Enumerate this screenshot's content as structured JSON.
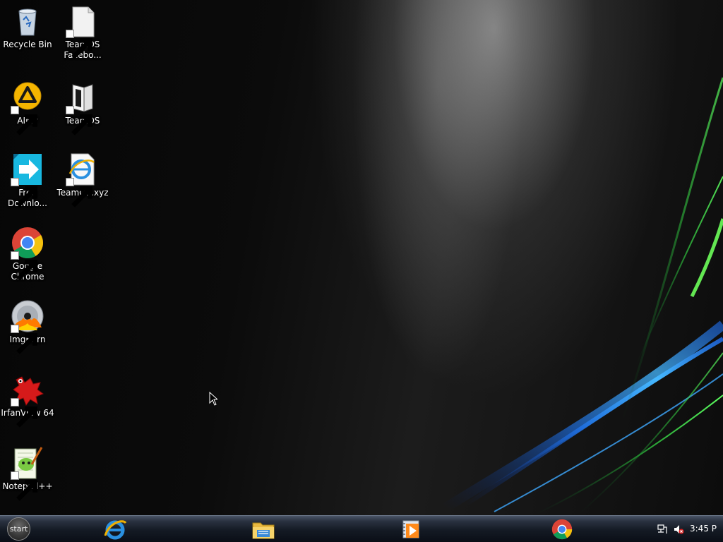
{
  "desktop": {
    "icons": [
      {
        "name": "recycle-bin",
        "label": "Recycle Bin",
        "icon": "recycle-bin-icon",
        "shortcut": false
      },
      {
        "name": "teamos-facebook",
        "label": "TeamOS Facebo...",
        "icon": "blank-document-icon",
        "shortcut": true
      },
      {
        "name": "aimp",
        "label": "AIMP",
        "icon": "aimp-icon",
        "shortcut": true
      },
      {
        "name": "teamos",
        "label": "TeamOS",
        "icon": "folder-icon",
        "shortcut": true
      },
      {
        "name": "free-download",
        "label": "Free Downlo...",
        "icon": "free-download-manager-icon",
        "shortcut": true
      },
      {
        "name": "teamos-xyz",
        "label": "TeamOS.xyz",
        "icon": "internet-shortcut-icon",
        "shortcut": true
      },
      {
        "name": "google-chrome",
        "label": "Google Chrome",
        "icon": "chrome-icon",
        "shortcut": true
      },
      {
        "name": "imgburn",
        "label": "ImgBurn",
        "icon": "imgburn-disc-icon",
        "shortcut": true
      },
      {
        "name": "irfanview",
        "label": "IrfanView 64",
        "icon": "irfanview-icon",
        "shortcut": true
      },
      {
        "name": "notepad-plus-plus",
        "label": "Notepad++",
        "icon": "notepad-plus-plus-icon",
        "shortcut": true
      }
    ]
  },
  "taskbar": {
    "start_label": "start",
    "pinned": [
      {
        "name": "internet-explorer",
        "icon": "internet-explorer-icon"
      },
      {
        "name": "file-explorer",
        "icon": "file-explorer-icon"
      },
      {
        "name": "media-player",
        "icon": "media-player-icon"
      },
      {
        "name": "chrome",
        "icon": "chrome-icon"
      }
    ],
    "tray": {
      "icons": [
        "network-icon",
        "volume-muted-icon"
      ],
      "clock": "3:45 P"
    }
  },
  "colors": {
    "swoosh_blue": "#2a9cff",
    "swoosh_green": "#3ddc4a",
    "taskbar_dark": "#0a0e16"
  }
}
